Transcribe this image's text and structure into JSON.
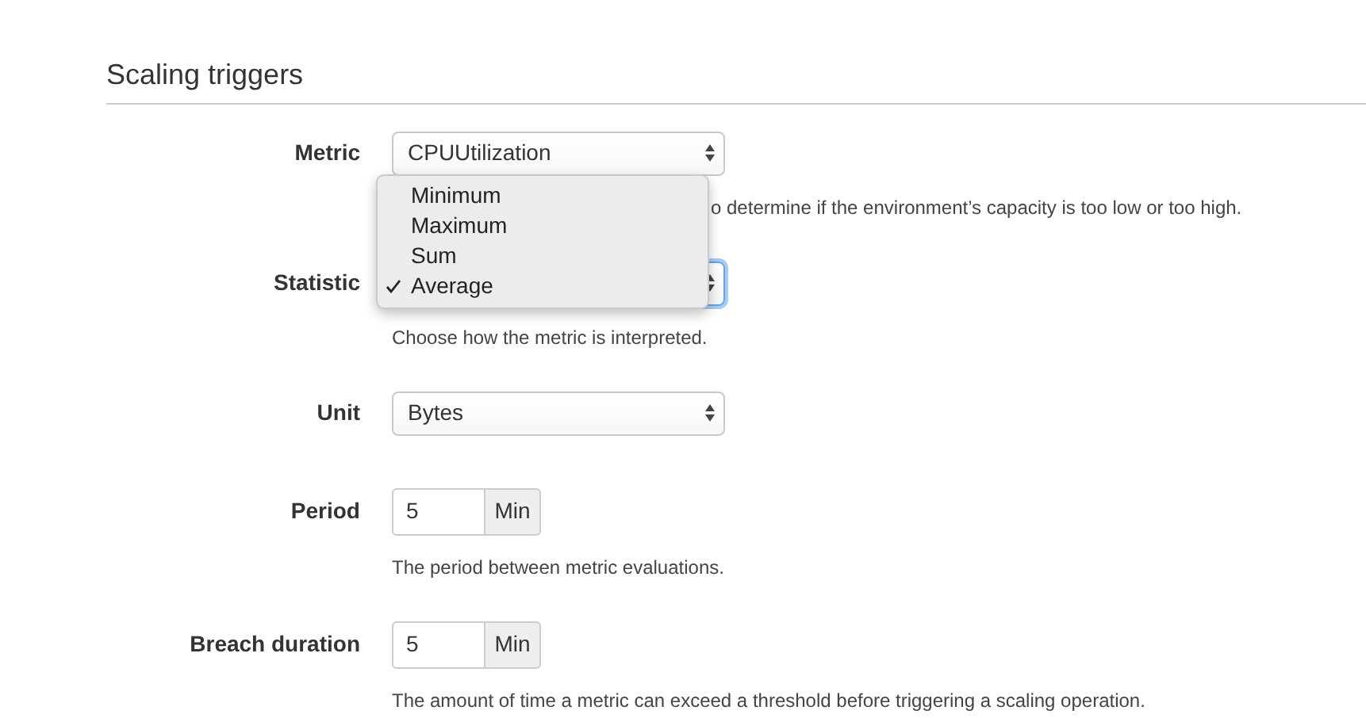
{
  "section": {
    "title": "Scaling triggers"
  },
  "fields": [
    {
      "kind": "select",
      "label": "Metric",
      "value": "CPUUtilization",
      "focused": false,
      "help": "o determine if the environment’s capacity is too low or too high."
    },
    {
      "kind": "select",
      "label": "Statistic",
      "focused": true,
      "dropdown": {
        "options": [
          {
            "label": "Minimum",
            "selected": false
          },
          {
            "label": "Maximum",
            "selected": false
          },
          {
            "label": "Sum",
            "selected": false
          },
          {
            "label": "Average",
            "selected": true
          }
        ]
      },
      "help": "Choose how the metric is interpreted."
    },
    {
      "kind": "select",
      "label": "Unit",
      "value": "Bytes",
      "focused": false
    },
    {
      "kind": "number",
      "label": "Period",
      "value": "5",
      "unit": "Min",
      "help": "The period between metric evaluations."
    },
    {
      "kind": "number",
      "label": "Breach duration",
      "value": "5",
      "unit": "Min",
      "help": "The amount of time a metric can exceed a threshold before triggering a scaling operation."
    }
  ]
}
